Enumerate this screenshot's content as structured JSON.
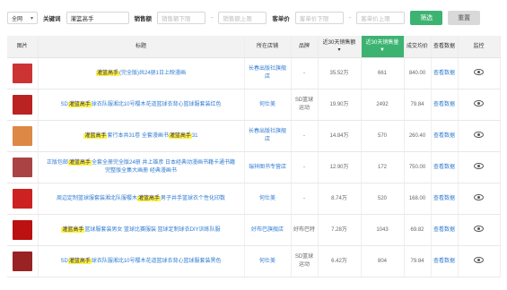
{
  "filter": {
    "scope": "全网",
    "keyword_label": "关键词",
    "keyword_value": "灌篮高手",
    "sales_label": "销售额",
    "sales_min_placeholder": "销售额下限",
    "sales_max_placeholder": "销售额上限",
    "price_label": "客单价",
    "price_min_placeholder": "客单价下限",
    "price_max_placeholder": "客单价上限",
    "filter_button": "筛选",
    "reset_button": "重置"
  },
  "table": {
    "headers": [
      "图片",
      "标题",
      "所在店铺",
      "品牌",
      "近30天销售额",
      "近30天销售量",
      "成交均价",
      "查看数据",
      "监控"
    ],
    "sort_arrow": "▼",
    "rows": [
      {
        "thumb": "#c33",
        "title_pre": "",
        "title_hl": "灌篮高手",
        "title_post": "(完全版)共24册1日上映漫画",
        "shop": "长春出版社旗舰店",
        "brand": "-",
        "sales": "35.52万",
        "volume": "661",
        "price": "840.00",
        "view": "查看数据"
      },
      {
        "thumb": "#b22",
        "title_pre": "SD",
        "title_hl": "灌篮高手",
        "title_post": "球衣队服湘北10号樱木花道篮球衣背心篮球服套装红色",
        "shop": "何仕美",
        "brand": "SD篮球运动",
        "sales": "19.90万",
        "volume": "2492",
        "price": "79.84",
        "view": "查看数据"
      },
      {
        "thumb": "#d84",
        "title_pre": "",
        "title_hl": "灌篮高手",
        "title_post": "套行本共31卷 全套漫画书",
        "title_hl2": "灌篮高手",
        "title_post2": "31",
        "shop": "长春出版社旗舰店",
        "brand": "-",
        "sales": "14.84万",
        "volume": "570",
        "price": "260.40",
        "view": "查看数据"
      },
      {
        "thumb": "#a44",
        "title_pre": "正版包邮",
        "title_hl": "灌篮高手",
        "title_post": "全套全册完全版24册 井上雄彦 日本经典动漫画书籍卡通书籍 完整版全集大画册 经典漫画书",
        "shop": "瑞祥图书专营店",
        "brand": "-",
        "sales": "12.90万",
        "volume": "172",
        "price": "750.00",
        "view": "查看数据"
      },
      {
        "thumb": "#c22",
        "title_pre": "周边定制篮球服套装湘北队服樱木",
        "title_hl": "灌篮高手",
        "title_post": "男子井手篮球衣个性化印数",
        "shop": "何仕美",
        "brand": "-",
        "sales": "8.74万",
        "volume": "520",
        "price": "168.00",
        "view": "查看数据"
      },
      {
        "thumb": "#b11",
        "title_pre": "",
        "title_hl": "灌篮高手",
        "title_post": "篮球服套装男女 篮球比赛服装 篮球定制球衣DIY训练队服",
        "shop": "好布巴旗舰店",
        "brand": "好布巴特",
        "sales": "7.28万",
        "volume": "1043",
        "price": "69.82",
        "view": "查看数据"
      },
      {
        "thumb": "#922",
        "title_pre": "SD",
        "title_hl": "灌篮高手",
        "title_post": "球衣队服湘北10号樱木花道篮球衣背心篮球服套装黑色",
        "shop": "何仕美",
        "brand": "SD篮球运动",
        "sales": "6.42万",
        "volume": "804",
        "price": "79.84",
        "view": "查看数据"
      }
    ]
  }
}
